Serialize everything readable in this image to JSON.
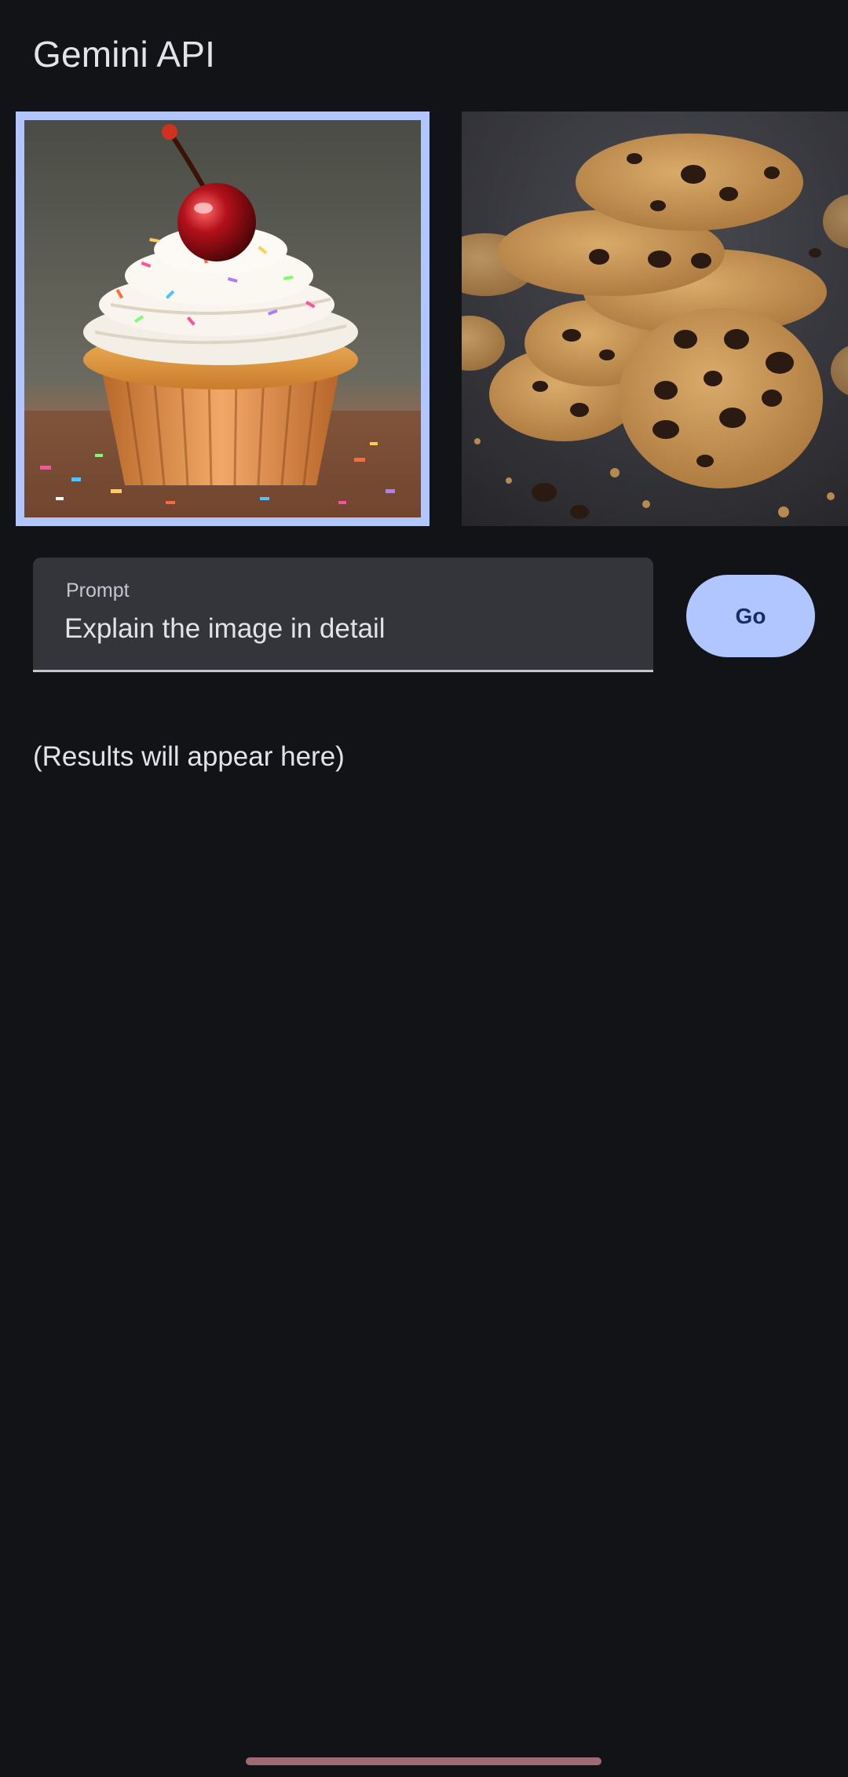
{
  "app": {
    "title": "Gemini API"
  },
  "images": [
    {
      "name": "cupcake",
      "selected": true
    },
    {
      "name": "cookies",
      "selected": false
    }
  ],
  "prompt": {
    "label": "Prompt",
    "value": "Explain the image in detail"
  },
  "go_button": {
    "label": "Go"
  },
  "results": {
    "placeholder": "(Results will appear here)"
  },
  "colors": {
    "background": "#111317",
    "accent": "#b1c5ff",
    "field": "#33353b",
    "home_indicator": "#9e6b74"
  }
}
